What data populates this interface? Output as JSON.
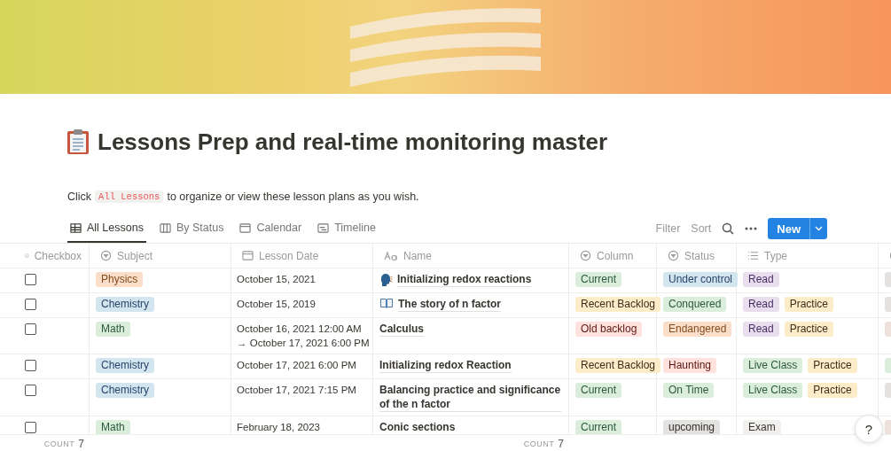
{
  "page": {
    "title": "Lessons Prep and real-time monitoring master",
    "intro": {
      "before": "Click",
      "code": "All Lessons",
      "after": "to organize or view these lesson plans as you wish."
    }
  },
  "tabs": [
    {
      "label": "All Lessons",
      "kind": "table",
      "selected": true
    },
    {
      "label": "By Status",
      "kind": "board",
      "selected": false
    },
    {
      "label": "Calendar",
      "kind": "calendar",
      "selected": false
    },
    {
      "label": "Timeline",
      "kind": "timeline",
      "selected": false
    }
  ],
  "toolbar": {
    "filter": "Filter",
    "sort": "Sort",
    "new": "New"
  },
  "table": {
    "columns": [
      {
        "label": "Checkbox",
        "kind": "checkbox"
      },
      {
        "label": "Subject",
        "kind": "select"
      },
      {
        "label": "Lesson Date",
        "kind": "date"
      },
      {
        "label": "Name",
        "kind": "title"
      },
      {
        "label": "Column",
        "kind": "select"
      },
      {
        "label": "Status",
        "kind": "select"
      },
      {
        "label": "Type",
        "kind": "multi"
      },
      {
        "kind": "select"
      }
    ],
    "rows": [
      {
        "checked": false,
        "subject": {
          "text": "Physics",
          "color": "#fadec9"
        },
        "date": [
          "October 15, 2021"
        ],
        "name": {
          "text": "Initializing redox reactions",
          "kind": "speaker"
        },
        "column": {
          "text": "Current",
          "color": "#dbeddb"
        },
        "status": {
          "text": "Under control",
          "color": "#d3e5ef"
        },
        "type": [
          {
            "text": "Read",
            "color": "#e8deee"
          }
        ],
        "column_9": {
          "color": "#e3e2e0"
        }
      },
      {
        "checked": false,
        "subject": {
          "text": "Chemistry",
          "color": "#d3e5ef"
        },
        "date": [
          "October 15, 2019"
        ],
        "name": {
          "text": "The story of n factor",
          "kind": "book"
        },
        "column": {
          "text": "Recent Backlog",
          "color": "#fdecc8"
        },
        "status": {
          "text": "Conquered",
          "color": "#dbeddb"
        },
        "type": [
          {
            "text": "Read",
            "color": "#e8deee"
          },
          {
            "text": "Practice",
            "color": "#fdecc8"
          }
        ],
        "column_9": {
          "color": "#e3e2e0"
        }
      },
      {
        "checked": false,
        "subject": {
          "text": "Math",
          "color": "#dbeddb"
        },
        "date": [
          "October 16, 2021 12:00 AM",
          "→ October 17, 2021 6:00 PM"
        ],
        "name": {
          "text": "Calculus",
          "kind": "plain"
        },
        "column": {
          "text": "Old backlog",
          "color": "#ffe2dd"
        },
        "status": {
          "text": "Endangered",
          "color": "#fadec9"
        },
        "type": [
          {
            "text": "Read",
            "color": "#e8deee"
          },
          {
            "text": "Practice",
            "color": "#fdecc8"
          }
        ],
        "column_9": {
          "color": "#eee0da"
        }
      },
      {
        "checked": false,
        "subject": {
          "text": "Chemistry",
          "color": "#d3e5ef"
        },
        "date": [
          "October 17, 2021 6:00 PM"
        ],
        "name": {
          "text": "Initializing redox Reaction",
          "kind": "plain"
        },
        "column": {
          "text": "Recent Backlog",
          "color": "#fdecc8"
        },
        "status": {
          "text": "Haunting",
          "color": "#ffe2dd"
        },
        "type": [
          {
            "text": "Live Class",
            "color": "#dbeddb"
          },
          {
            "text": "Practice",
            "color": "#fdecc8"
          }
        ],
        "column_9": {
          "color": "#dbeddb"
        }
      },
      {
        "checked": false,
        "subject": {
          "text": "Chemistry",
          "color": "#d3e5ef"
        },
        "date": [
          "October 17, 2021 7:15 PM"
        ],
        "name": {
          "text": "Balancing practice and significance of the n factor",
          "kind": "plain"
        },
        "column": {
          "text": "Current",
          "color": "#dbeddb"
        },
        "status": {
          "text": "On Time",
          "color": "#dbeddb"
        },
        "type": [
          {
            "text": "Live Class",
            "color": "#dbeddb"
          },
          {
            "text": "Practice",
            "color": "#fdecc8"
          }
        ],
        "column_9": {
          "color": "#e3e2e0"
        }
      },
      {
        "checked": false,
        "subject": {
          "text": "Math",
          "color": "#dbeddb"
        },
        "date": [
          "February 18, 2023"
        ],
        "name": {
          "text": "Conic sections",
          "kind": "plain"
        },
        "column": {
          "text": "Current",
          "color": "#dbeddb"
        },
        "status": {
          "text": "upcoming",
          "color": "#e3e2e0"
        },
        "type": [
          {
            "text": "Exam",
            "color": "#f1f0ef"
          }
        ],
        "column_9": {
          "color": "#eee0da"
        }
      }
    ],
    "footer": [
      {
        "label": "COUNT",
        "value": "7"
      },
      {
        "label": "COUNT",
        "value": "7"
      }
    ]
  },
  "help": "?"
}
